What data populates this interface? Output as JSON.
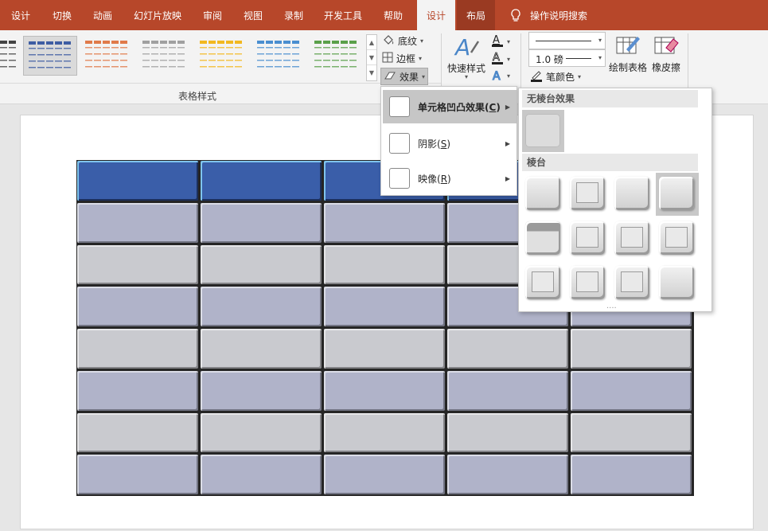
{
  "tabs": [
    "设计",
    "切换",
    "动画",
    "幻灯片放映",
    "审阅",
    "视图",
    "录制",
    "开发工具",
    "帮助",
    "设计",
    "布局",
    "操作说明搜索"
  ],
  "ribbon": {
    "shading": "底纹",
    "border": "边框",
    "effects": "效果",
    "quick_styles": "快速样式",
    "pen_weight": "1.0 磅",
    "pen_color": "笔颜色",
    "draw_table": "绘制表格",
    "eraser": "橡皮擦",
    "table_styles_label": "表格样式"
  },
  "colors": {
    "accent": "#b7472a",
    "header_cell": "#3a5ea9",
    "band_dark": "#b0b3c9",
    "band_light": "#c9cacf"
  },
  "gallery_colors": [
    "#444444",
    "#3e5da3",
    "#e07a4a",
    "#a0a0a0",
    "#f2b820",
    "#4a8ed0",
    "#5aa04a"
  ],
  "menu": {
    "items": [
      {
        "label": "单元格凹凸效果",
        "key": "C"
      },
      {
        "label": "阴影",
        "key": "S"
      },
      {
        "label": "映像",
        "key": "R"
      }
    ]
  },
  "submenu": {
    "no_bevel": "无棱台效果",
    "bevel": "棱台",
    "more": "...."
  }
}
